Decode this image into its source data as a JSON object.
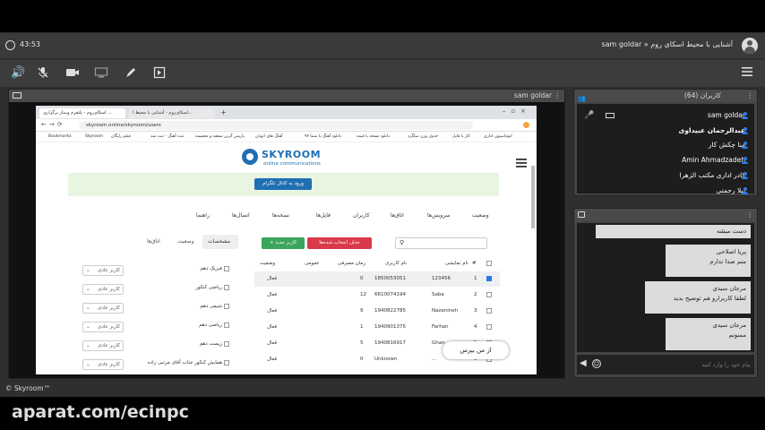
{
  "topbar": {
    "time": "43:53",
    "title": "sam goldar » آشنایی با محیط اسکای روم"
  },
  "toolbar": {
    "icons": [
      "speaker-icon",
      "mic-muted-icon",
      "camera-icon",
      "screen-icon",
      "pen-icon",
      "whiteboard-icon",
      "menu-icon"
    ]
  },
  "share_panel": {
    "title": "sam goldar",
    "browser": {
      "tabs": [
        "اسکای‌روم - پلتفرم وبینار برگزاری ...",
        "اسکای‌روم - آشنایی با محیط ا..."
      ],
      "url": "skyroom.online/skyroom/users",
      "bookmarks": [
        "Bookmarks",
        "Skyroom",
        "فیلم رایگان",
        "ثبت آهنگ - ثبت شد",
        "سقفه و مجسمه",
        "پاریس گرین",
        "آهنگ های اتوبان",
        "دانلود آهنگ با شما ۷۷",
        "دانلود نسخه با قیمه",
        "جدول وزن میلگرد",
        "کار با فایل",
        "اتوماسیون اداری"
      ],
      "logo_name": "SKYROOM",
      "logo_sub": "online communications",
      "green_button": "ورود به کانال تلگرام",
      "nav": [
        "وضعیت",
        "سرویس‌ها",
        "اتاق‌ها",
        "کاربران",
        "فایل‌ها",
        "نسخه‌ها",
        "اتصال‌ها",
        "راهنما"
      ],
      "tabs_small": [
        "مشخصات",
        "وضعیت",
        "اتاق‌ها"
      ],
      "add_button": "+ کاربر جدید",
      "delete_button": "حذف انتخاب شده‌ها",
      "table": {
        "headers": [
          "#",
          "نام نمایشی",
          "نام کاربری",
          "زمان مصرفی",
          "عمومی",
          "وضعیت"
        ],
        "rows": [
          {
            "n": "1",
            "display": "123456",
            "user": "1850053051",
            "time": "0",
            "status": "فعال"
          },
          {
            "n": "2",
            "display": "Saba",
            "user": "6610074194",
            "time": "12",
            "status": "فعال"
          },
          {
            "n": "3",
            "display": "Nazanineh",
            "user": "1940822785",
            "time": "9",
            "status": "فعال"
          },
          {
            "n": "4",
            "display": "Farhan",
            "user": "1940901375",
            "time": "1",
            "status": "فعال"
          },
          {
            "n": "5",
            "display": "Ghan",
            "user": "1940816917",
            "time": "5",
            "status": "فعال"
          },
          {
            "n": "6",
            "display": "...",
            "user": "Unknown",
            "time": "0",
            "status": "فعال"
          }
        ]
      },
      "permissions": [
        "فیزیک دهم",
        "ریاضی کنکور",
        "شیمی دهم",
        "ریاضی دهم",
        "زیست دهم",
        "همایش کنکور جناب آقای مرتبی زاده"
      ],
      "role_default": "کاربر عادی",
      "tooltip": "از من بپرس"
    }
  },
  "users_panel": {
    "title": "کاربران (64)",
    "users": [
      "sam goldar",
      "عبدالرحمان عبیداوی",
      "منا چکش کار",
      "Amin Ahmadzadeh",
      "کادر اداری مکتب الزهرا",
      "لیلا رحمتی"
    ]
  },
  "chat_panel": {
    "messages": [
      {
        "name": "",
        "text": "دست میشه"
      },
      {
        "name": "پریا اصلاحی",
        "text": "منم صدا ندارم"
      },
      {
        "name": "مرجان سیدی",
        "text": "لطفا کاربرارو هم توضیح بدید"
      },
      {
        "name": "مرجان سیدی",
        "text": "ممنونم"
      }
    ],
    "input_placeholder": "پیام خود را وارد کنید"
  },
  "footer": {
    "brand": "© Skyroom™"
  },
  "watermark": "aparat.com/ecinpc",
  "colors": {
    "accent_blue": "#2c7be5",
    "skyroom_blue": "#1f6fb2",
    "green": "#3aa55b",
    "red": "#d9394a"
  }
}
